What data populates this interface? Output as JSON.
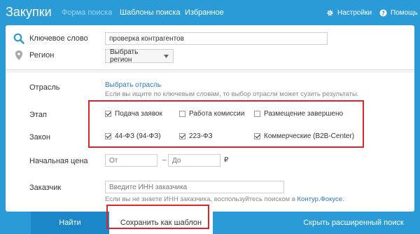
{
  "header": {
    "title": "Закупки",
    "tabs": [
      {
        "label": "Форма поиска",
        "active": true
      },
      {
        "label": "Шаблоны поиска",
        "active": false
      },
      {
        "label": "Избранное",
        "active": false
      }
    ],
    "settings_label": "Настройки",
    "help_label": "Помощь"
  },
  "form": {
    "keyword": {
      "label": "Ключевое слово",
      "value": "проверка контрагентов"
    },
    "region": {
      "label": "Регион",
      "select_label": "Выбрать регион"
    },
    "industry": {
      "label": "Отрасль",
      "link": "Выбрать отрасль",
      "hint": "Если вы ищите по ключевым словам, то выбор отрасли может сузить результаты."
    },
    "stage": {
      "label": "Этап",
      "options": [
        {
          "label": "Подача заявок",
          "checked": true
        },
        {
          "label": "Работа комиссии",
          "checked": false
        },
        {
          "label": "Размещение завершено",
          "checked": false
        }
      ]
    },
    "law": {
      "label": "Закон",
      "options": [
        {
          "label": "44-ФЗ (94-ФЗ)",
          "checked": true
        },
        {
          "label": "223-ФЗ",
          "checked": true
        },
        {
          "label": "Коммерческие (B2B-Center)",
          "checked": true
        }
      ]
    },
    "price": {
      "label": "Начальная цена",
      "from_placeholder": "От",
      "separator": "–",
      "to_placeholder": "До",
      "currency": "₽"
    },
    "customer": {
      "label": "Заказчик",
      "placeholder": "Введите ИНН заказчика",
      "hint_prefix": "Если вы не знаете ИНН заказчика, воспользуйтесь поиском в",
      "hint_link": "Контур.Фокусе",
      "hint_suffix": "."
    }
  },
  "actions": {
    "find": "Найти",
    "save_template": "Сохранить как шаблон",
    "advanced_search": "Скрыть расширенный поиск"
  },
  "colors": {
    "header_bg": "#2a9bd6",
    "active_tab": "#9ad6f5",
    "find_button": "#1b87c8",
    "highlight_border": "#e0222a",
    "link": "#2b7ac0"
  }
}
